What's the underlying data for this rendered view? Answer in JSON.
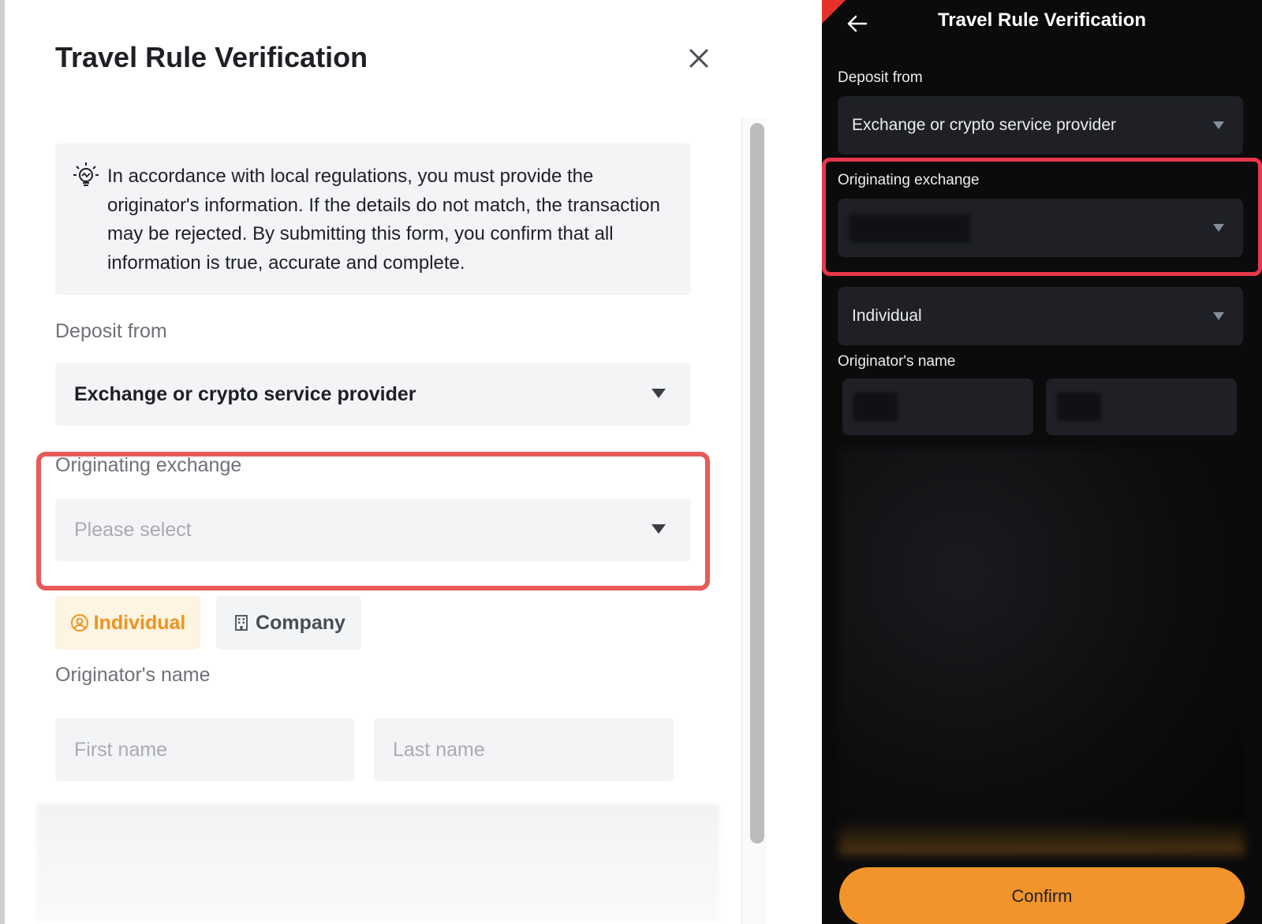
{
  "left": {
    "title": "Travel Rule Verification",
    "notice": "In accordance with local regulations, you must provide the originator's information. If the details do not match, the transaction may be rejected. By submitting this form, you confirm that all information is true, accurate and complete.",
    "deposit_from_label": "Deposit from",
    "deposit_from_value": "Exchange or crypto service provider",
    "originating_exchange_label": "Originating exchange",
    "originating_exchange_placeholder": "Please select",
    "individual_label": "Individual",
    "company_label": "Company",
    "originator_name_label": "Originator's name",
    "first_name_placeholder": "First name",
    "last_name_placeholder": "Last name"
  },
  "right": {
    "title": "Travel Rule Verification",
    "deposit_from_label": "Deposit from",
    "deposit_from_value": "Exchange or crypto service provider",
    "originating_exchange_label": "Originating exchange",
    "type_value": "Individual",
    "originator_name_label": "Originator's name",
    "confirm_label": "Confirm"
  },
  "colors": {
    "highlight": "#e85a57",
    "accent_orange": "#f0942b",
    "dark_bg": "#0b0b0c"
  },
  "icons": {
    "close": "close-icon",
    "notice": "lightbulb-icon",
    "individual": "user-circle-icon",
    "company": "building-icon",
    "back": "arrow-left-icon"
  }
}
